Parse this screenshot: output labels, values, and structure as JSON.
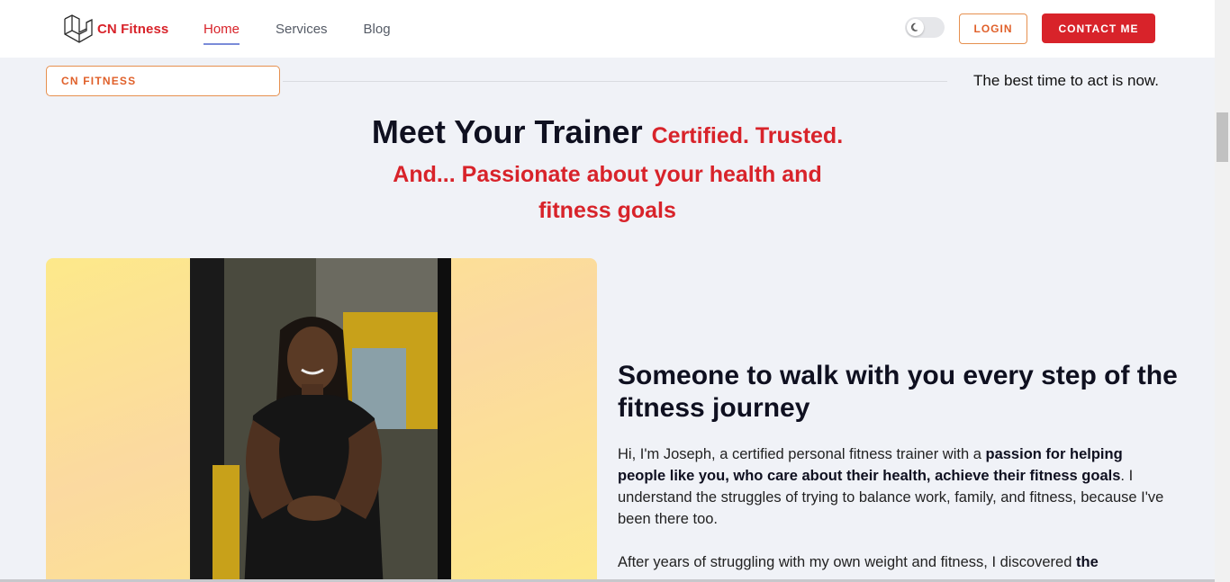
{
  "header": {
    "logo_text": "CN Fitness",
    "nav": [
      "Home",
      "Services",
      "Blog"
    ],
    "active_nav": "Home",
    "theme_toggle_icon": "moon-icon",
    "login_label": "LOGIN",
    "contact_label": "CONTACT ME"
  },
  "intro": {
    "tag": "CN FITNESS",
    "tagline": "The best time to act is now."
  },
  "heading": {
    "main": "Meet Your Trainer",
    "accent1": "Certified. Trusted.",
    "accent2": "And... Passionate about your health and",
    "accent3": "fitness goals"
  },
  "about": {
    "title": "Someone to walk with you every step of the fitness journey",
    "p1_a": "Hi, I'm Joseph, a certified personal fitness trainer with a ",
    "p1_b": "passion for helping people like you, who care about their health, achieve their fitness goals",
    "p1_c": ". I understand the struggles of trying to balance work, family, and fitness, because I've been there too.",
    "p2_a": "After years of struggling with my own weight and fitness, I discovered ",
    "p2_b": "the"
  },
  "colors": {
    "brand_red": "#d8232a",
    "accent_orange": "#e0602a",
    "background": "#f0f2f7"
  }
}
